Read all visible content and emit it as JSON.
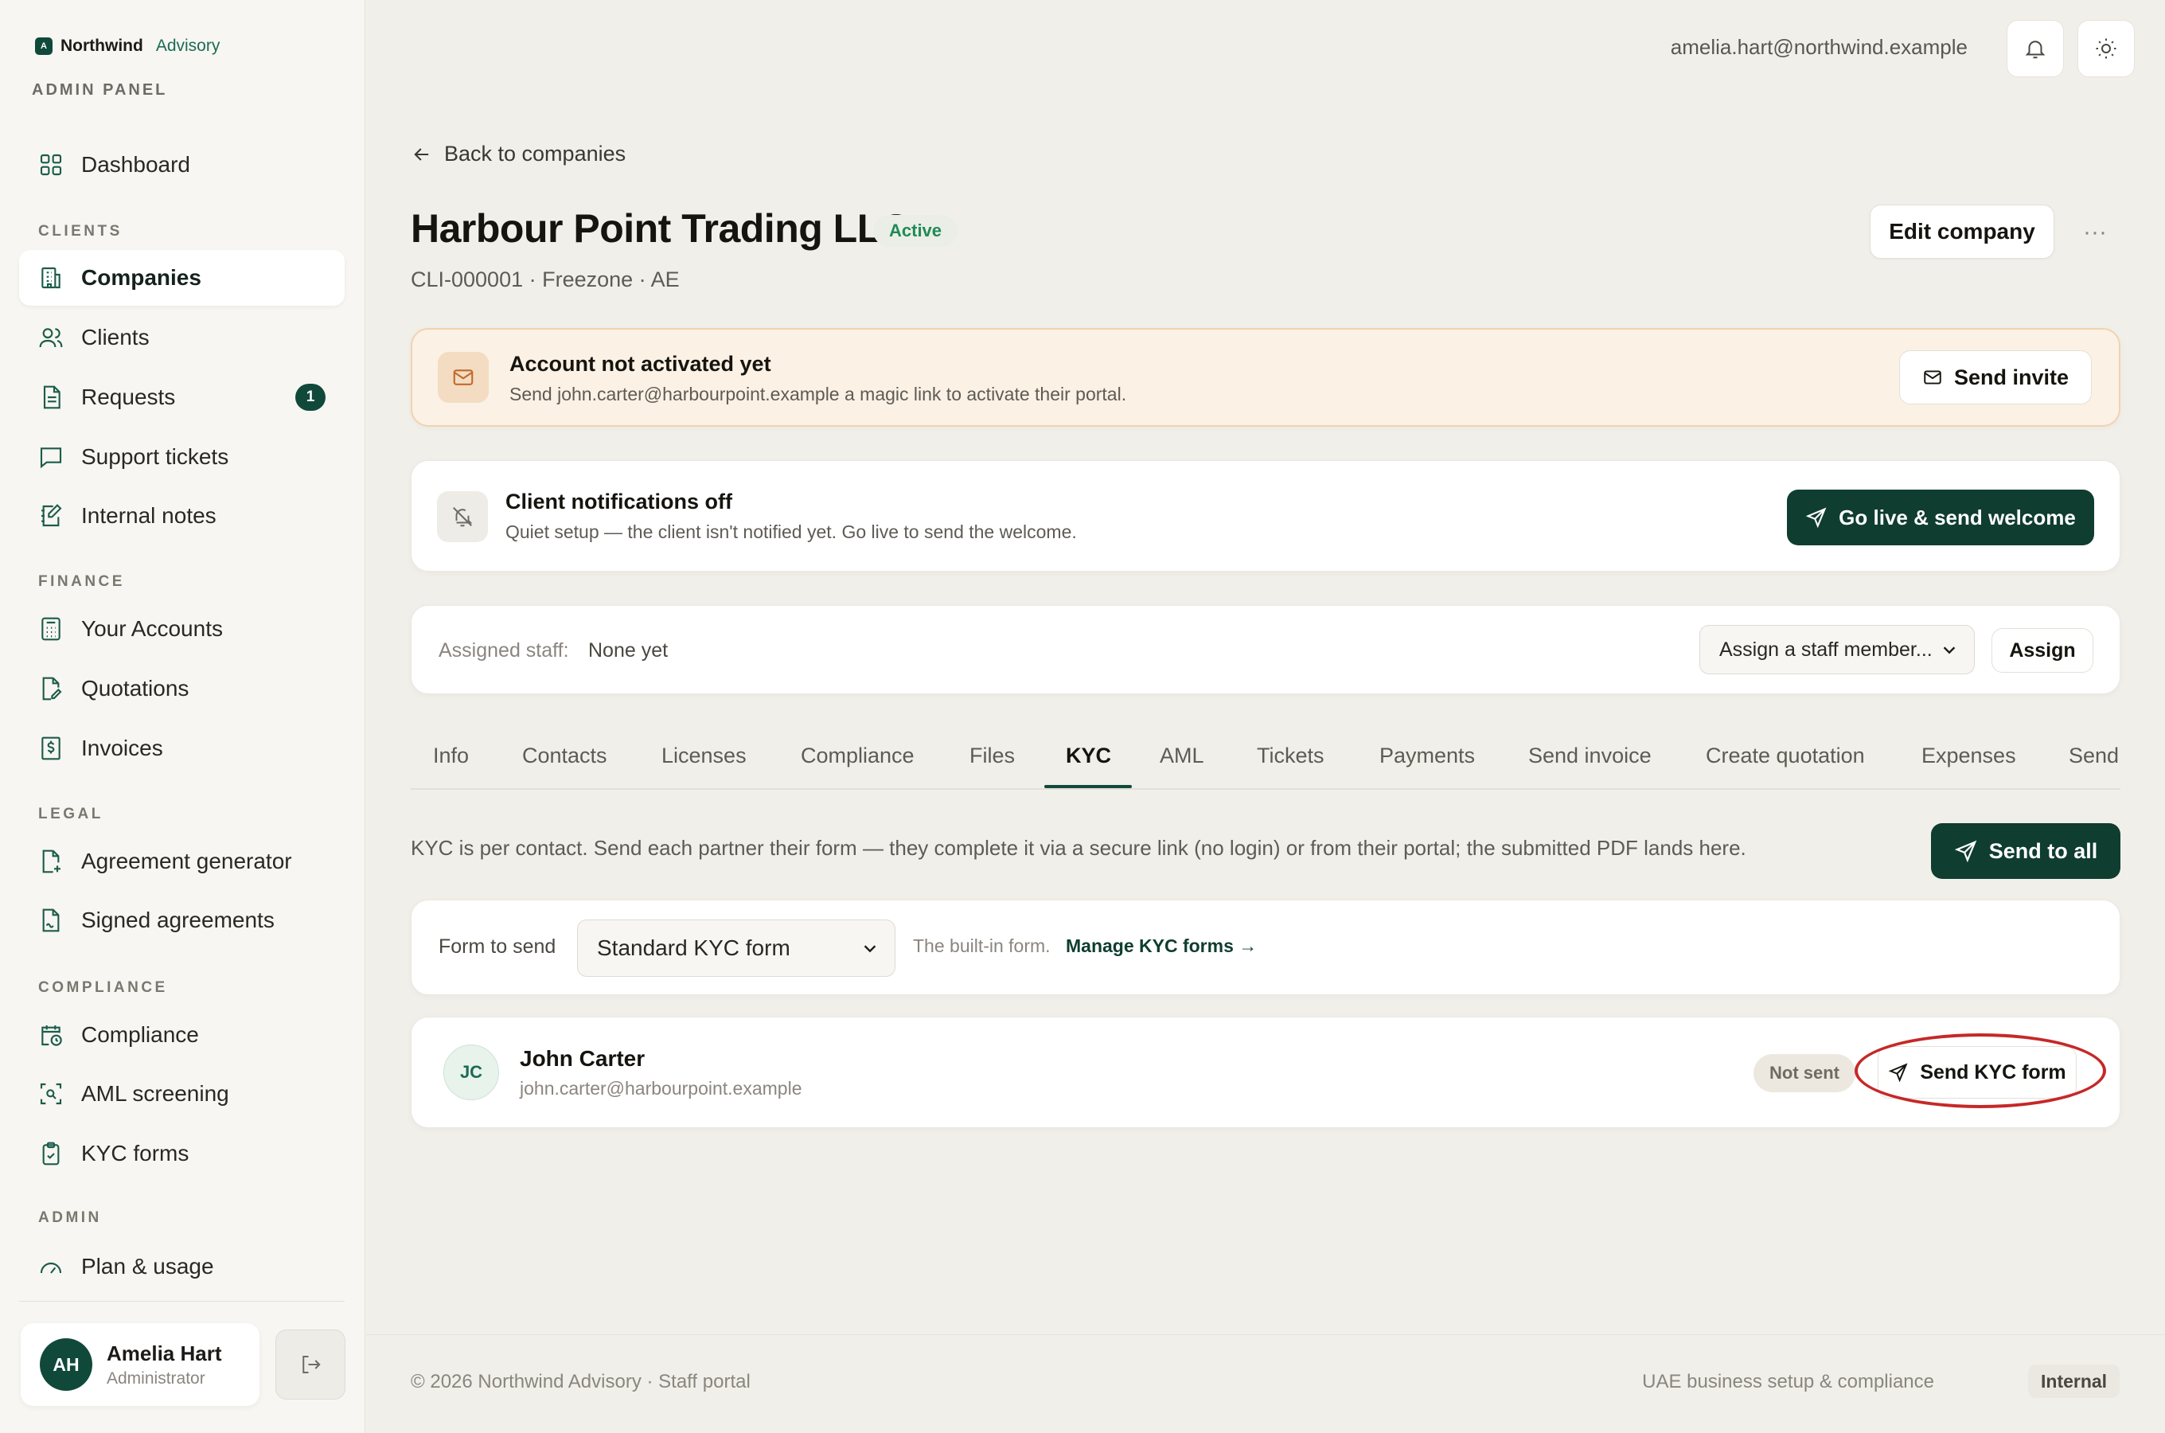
{
  "brand": {
    "logo_letter": "A",
    "name": "Northwind",
    "sub": "Advisory",
    "panel_label": "ADMIN PANEL"
  },
  "sidebar": {
    "dashboard": "Dashboard",
    "sections": {
      "clients": "CLIENTS",
      "finance": "FINANCE",
      "legal": "LEGAL",
      "compliance": "COMPLIANCE",
      "admin": "ADMIN"
    },
    "items": {
      "companies": "Companies",
      "clients": "Clients",
      "requests": "Requests",
      "requests_badge": "1",
      "support_tickets": "Support tickets",
      "internal_notes": "Internal notes",
      "your_accounts": "Your Accounts",
      "quotations": "Quotations",
      "invoices": "Invoices",
      "agreement_generator": "Agreement generator",
      "signed_agreements": "Signed agreements",
      "compliance": "Compliance",
      "aml_screening": "AML screening",
      "kyc_forms": "KYC forms",
      "plan_usage": "Plan & usage"
    },
    "user": {
      "initials": "AH",
      "name": "Amelia Hart",
      "role": "Administrator"
    }
  },
  "topbar": {
    "email": "amelia.hart@northwind.example"
  },
  "page": {
    "back_label": "Back to companies",
    "title": "Harbour Point Trading LLC",
    "status": "Active",
    "meta": "CLI-000001 · Freezone · AE",
    "edit_label": "Edit company",
    "more_label": "···"
  },
  "activation_banner": {
    "title": "Account not activated yet",
    "desc": "Send john.carter@harbourpoint.example a magic link to activate their portal.",
    "button": "Send invite"
  },
  "notifications_banner": {
    "title": "Client notifications off",
    "desc": "Quiet setup — the client isn't notified yet. Go live to send the welcome.",
    "button": "Go live & send welcome"
  },
  "staff": {
    "label": "Assigned staff:",
    "value": "None yet",
    "select_value": "Assign a staff member...",
    "button": "Assign"
  },
  "tabs": [
    "Info",
    "Contacts",
    "Licenses",
    "Compliance",
    "Files",
    "KYC",
    "AML",
    "Tickets",
    "Payments",
    "Send invoice",
    "Create quotation",
    "Expenses",
    "Send"
  ],
  "active_tab": "KYC",
  "kyc": {
    "info": "KYC is per contact. Send each partner their form — they complete it via a secure link (no login) or from their portal; the submitted PDF lands here.",
    "send_all": "Send to all",
    "form_label": "Form to send",
    "form_value": "Standard KYC form",
    "form_hint": "The built-in form.",
    "manage_link": "Manage KYC forms →",
    "contact": {
      "initials": "JC",
      "name": "John Carter",
      "email": "john.carter@harbourpoint.example",
      "status": "Not sent",
      "button": "Send KYC form"
    }
  },
  "footer": {
    "left": "© 2026 Northwind Advisory · Staff portal",
    "right": "UAE business setup & compliance",
    "pill": "Internal"
  },
  "colors": {
    "accent": "#10493a",
    "highlight": "#c62828",
    "warning_bg": "#fbf1e5",
    "active_status": "#1f8a57"
  }
}
